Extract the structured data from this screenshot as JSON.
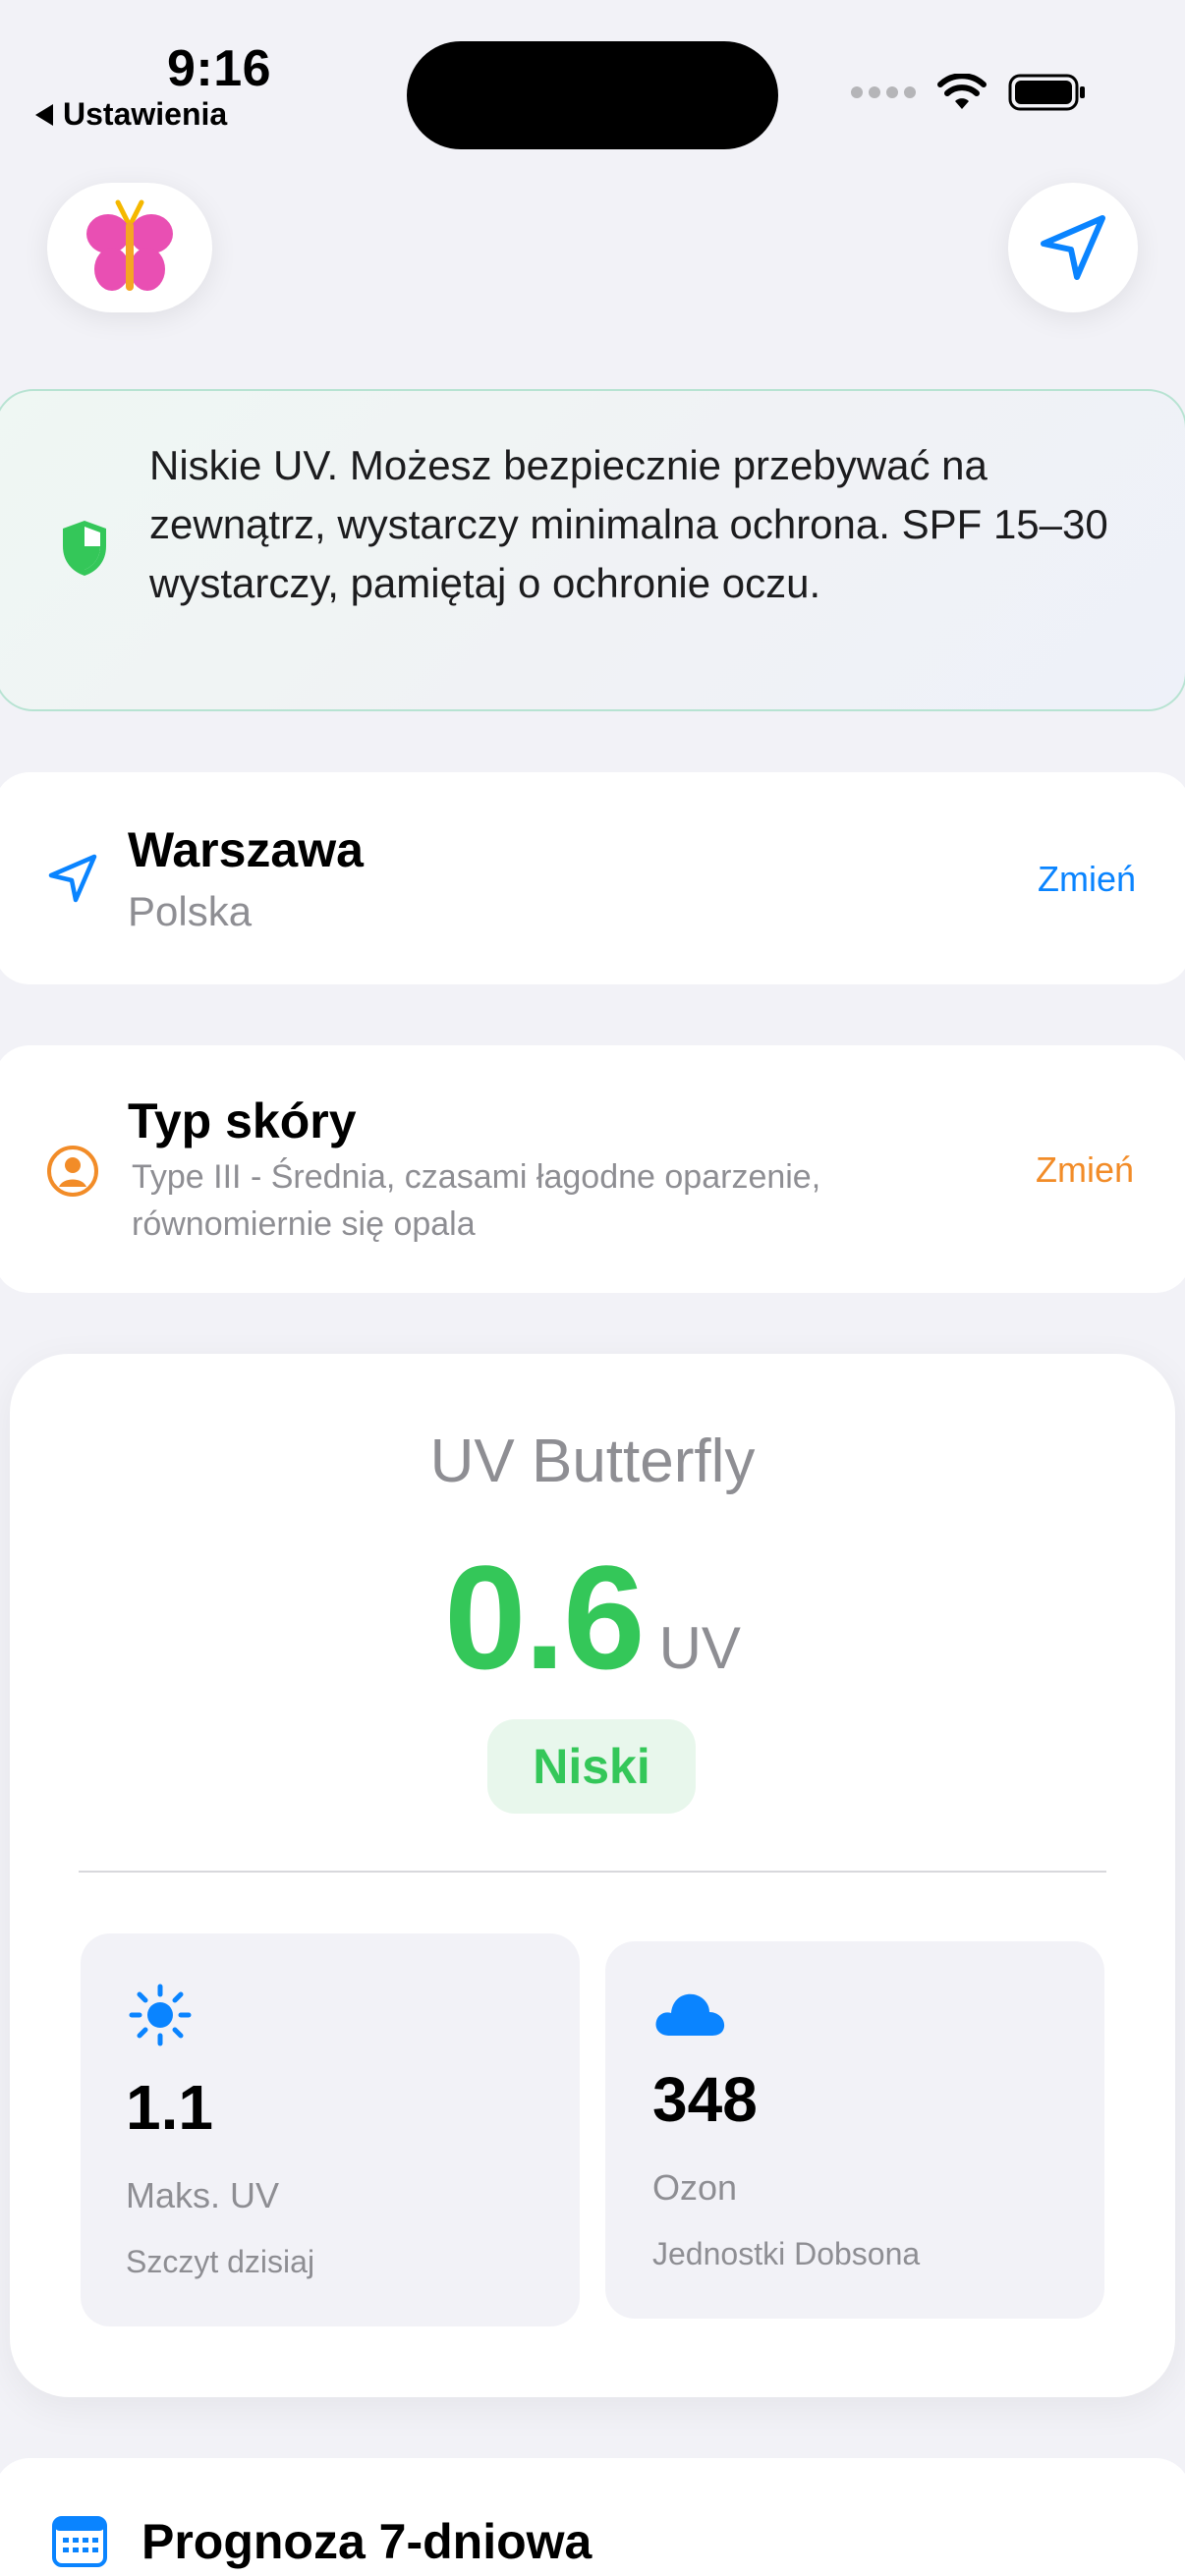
{
  "status_bar": {
    "time": "9:16",
    "back_label": "Ustawienia"
  },
  "header": {
    "logo_icon": "butterfly-logo-icon",
    "location_icon": "location-arrow-icon"
  },
  "advisory": {
    "icon": "shield-check-icon",
    "text": "Niskie UV. Możesz bezpiecznie przebywać na zewnątrz, wystarczy minimalna ochrona. SPF 15–30 wystarczy, pamiętaj o ochronie oczu."
  },
  "location": {
    "icon": "location-arrow-icon",
    "city": "Warszawa",
    "country": "Polska",
    "change_label": "Zmień",
    "accent": "#0A84FF"
  },
  "skin": {
    "icon": "person-circle-icon",
    "title": "Typ skóry",
    "description": "Type III - Średnia, czasami łagodne oparzenie, równomiernie się opala",
    "change_label": "Zmień",
    "accent": "#F28C28"
  },
  "uv": {
    "title": "UV Butterfly",
    "value": "0.6",
    "unit": "UV",
    "level_label": "Niski",
    "level_color": "#34C759"
  },
  "stats": [
    {
      "icon": "sun-icon",
      "value": "1.1",
      "label": "Maks. UV",
      "note": "Szczyt dzisiaj"
    },
    {
      "icon": "cloud-icon",
      "value": "348",
      "label": "Ozon",
      "note": "Jednostki Dobsona"
    }
  ],
  "forecast": {
    "icon": "calendar-icon",
    "title": "Prognoza 7-dniowa"
  }
}
